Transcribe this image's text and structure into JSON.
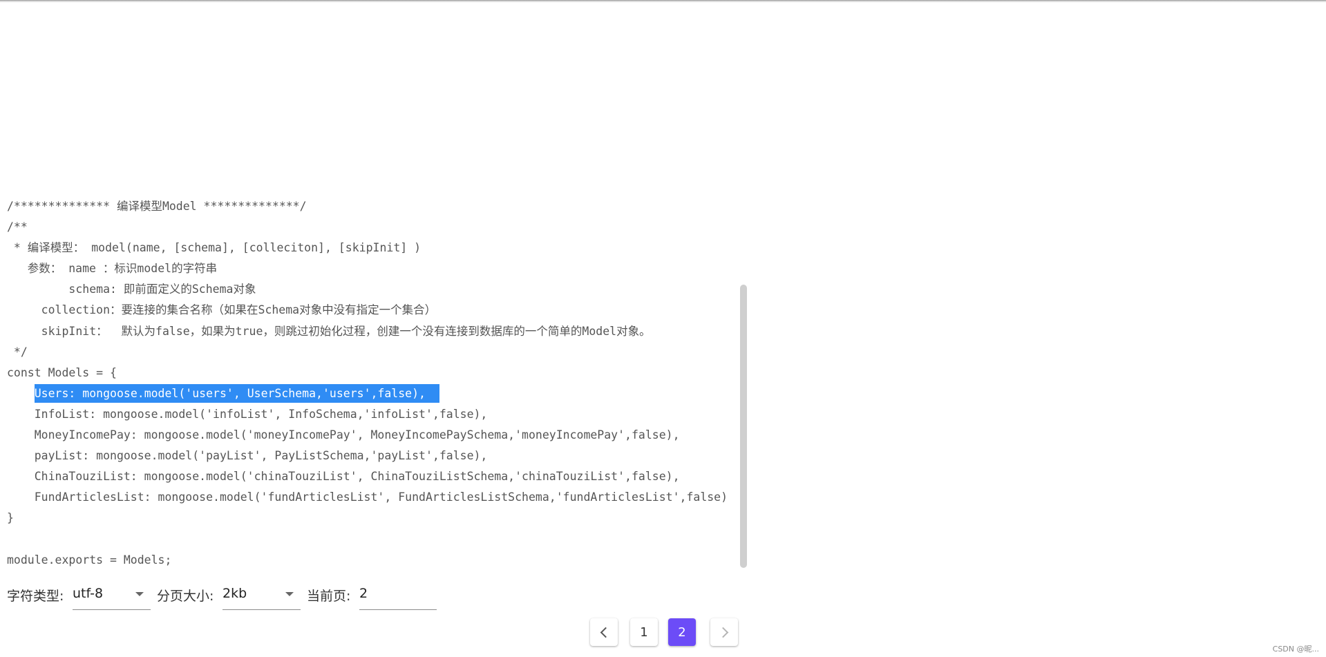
{
  "code": {
    "lines": [
      "/************** 编译模型Model **************/",
      "/**",
      " * 编译模型： model(name, [schema], [colleciton], [skipInit] )",
      "   参数： name ：标识model的字符串",
      "         schema: 即前面定义的Schema对象",
      "     collection：要连接的集合名称（如果在Schema对象中没有指定一个集合）",
      "     skipInit：  默认为false，如果为true，则跳过初始化过程，创建一个没有连接到数据库的一个简单的Model对象。",
      " */",
      "const Models = {",
      "",
      "    InfoList: mongoose.model('infoList', InfoSchema,'infoList',false),",
      "    MoneyIncomePay: mongoose.model('moneyIncomePay', MoneyIncomePaySchema,'moneyIncomePay',false),",
      "    payList: mongoose.model('payList', PayListSchema,'payList',false),",
      "    ChinaTouziList: mongoose.model('chinaTouziList', ChinaTouziListSchema,'chinaTouziList',false),",
      "    FundArticlesList: mongoose.model('fundArticlesList', FundArticlesListSchema,'fundArticlesList',false)",
      "}",
      "",
      "module.exports = Models;"
    ],
    "highlight_indent": "    ",
    "highlight_text": "Users: mongoose.model('users', UserSchema,'users',false),  "
  },
  "controls": {
    "charset_label": "字符类型:",
    "charset_value": "utf-8",
    "pagesize_label": "分页大小:",
    "pagesize_value": "2kb",
    "currentpage_label": "当前页:",
    "currentpage_value": "2"
  },
  "pagination": {
    "pages": [
      "1",
      "2"
    ],
    "active": "2"
  },
  "icons": {
    "prev": "chevron-left-icon",
    "next": "chevron-right-icon",
    "dropdown": "caret-down-icon"
  },
  "colors": {
    "selection": "#2f8cf4",
    "active_page": "#6c4cf7"
  },
  "watermark": "CSDN @昵..."
}
